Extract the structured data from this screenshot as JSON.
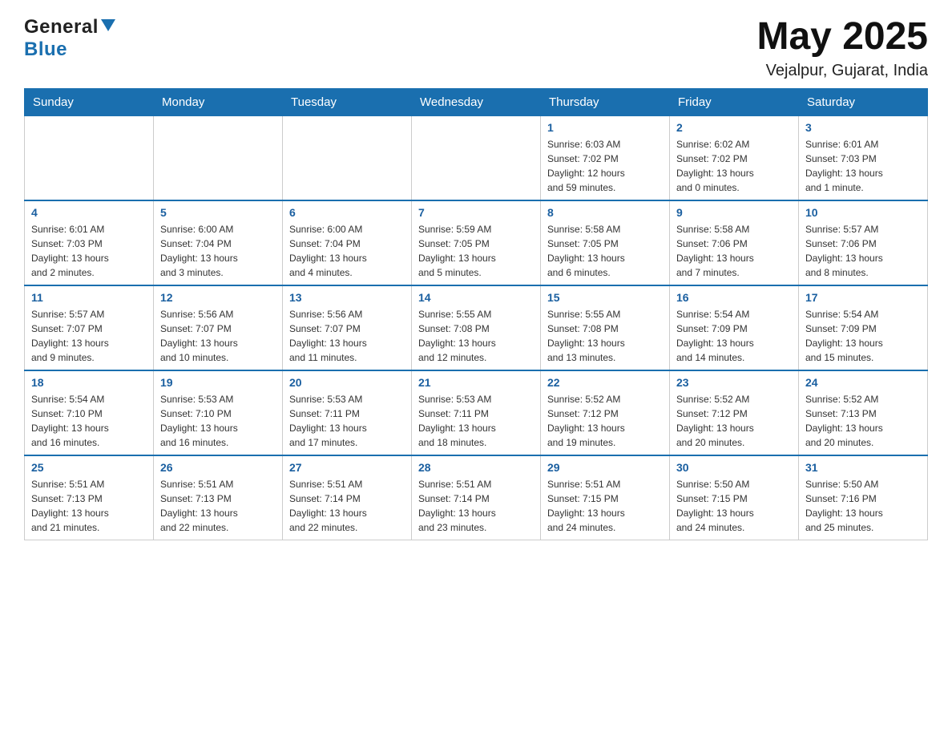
{
  "header": {
    "logo": {
      "general": "General",
      "blue": "Blue"
    },
    "title": "May 2025",
    "location": "Vejalpur, Gujarat, India"
  },
  "calendar": {
    "days_of_week": [
      "Sunday",
      "Monday",
      "Tuesday",
      "Wednesday",
      "Thursday",
      "Friday",
      "Saturday"
    ],
    "weeks": [
      {
        "days": [
          {
            "number": "",
            "info": ""
          },
          {
            "number": "",
            "info": ""
          },
          {
            "number": "",
            "info": ""
          },
          {
            "number": "",
            "info": ""
          },
          {
            "number": "1",
            "info": "Sunrise: 6:03 AM\nSunset: 7:02 PM\nDaylight: 12 hours\nand 59 minutes."
          },
          {
            "number": "2",
            "info": "Sunrise: 6:02 AM\nSunset: 7:02 PM\nDaylight: 13 hours\nand 0 minutes."
          },
          {
            "number": "3",
            "info": "Sunrise: 6:01 AM\nSunset: 7:03 PM\nDaylight: 13 hours\nand 1 minute."
          }
        ]
      },
      {
        "days": [
          {
            "number": "4",
            "info": "Sunrise: 6:01 AM\nSunset: 7:03 PM\nDaylight: 13 hours\nand 2 minutes."
          },
          {
            "number": "5",
            "info": "Sunrise: 6:00 AM\nSunset: 7:04 PM\nDaylight: 13 hours\nand 3 minutes."
          },
          {
            "number": "6",
            "info": "Sunrise: 6:00 AM\nSunset: 7:04 PM\nDaylight: 13 hours\nand 4 minutes."
          },
          {
            "number": "7",
            "info": "Sunrise: 5:59 AM\nSunset: 7:05 PM\nDaylight: 13 hours\nand 5 minutes."
          },
          {
            "number": "8",
            "info": "Sunrise: 5:58 AM\nSunset: 7:05 PM\nDaylight: 13 hours\nand 6 minutes."
          },
          {
            "number": "9",
            "info": "Sunrise: 5:58 AM\nSunset: 7:06 PM\nDaylight: 13 hours\nand 7 minutes."
          },
          {
            "number": "10",
            "info": "Sunrise: 5:57 AM\nSunset: 7:06 PM\nDaylight: 13 hours\nand 8 minutes."
          }
        ]
      },
      {
        "days": [
          {
            "number": "11",
            "info": "Sunrise: 5:57 AM\nSunset: 7:07 PM\nDaylight: 13 hours\nand 9 minutes."
          },
          {
            "number": "12",
            "info": "Sunrise: 5:56 AM\nSunset: 7:07 PM\nDaylight: 13 hours\nand 10 minutes."
          },
          {
            "number": "13",
            "info": "Sunrise: 5:56 AM\nSunset: 7:07 PM\nDaylight: 13 hours\nand 11 minutes."
          },
          {
            "number": "14",
            "info": "Sunrise: 5:55 AM\nSunset: 7:08 PM\nDaylight: 13 hours\nand 12 minutes."
          },
          {
            "number": "15",
            "info": "Sunrise: 5:55 AM\nSunset: 7:08 PM\nDaylight: 13 hours\nand 13 minutes."
          },
          {
            "number": "16",
            "info": "Sunrise: 5:54 AM\nSunset: 7:09 PM\nDaylight: 13 hours\nand 14 minutes."
          },
          {
            "number": "17",
            "info": "Sunrise: 5:54 AM\nSunset: 7:09 PM\nDaylight: 13 hours\nand 15 minutes."
          }
        ]
      },
      {
        "days": [
          {
            "number": "18",
            "info": "Sunrise: 5:54 AM\nSunset: 7:10 PM\nDaylight: 13 hours\nand 16 minutes."
          },
          {
            "number": "19",
            "info": "Sunrise: 5:53 AM\nSunset: 7:10 PM\nDaylight: 13 hours\nand 16 minutes."
          },
          {
            "number": "20",
            "info": "Sunrise: 5:53 AM\nSunset: 7:11 PM\nDaylight: 13 hours\nand 17 minutes."
          },
          {
            "number": "21",
            "info": "Sunrise: 5:53 AM\nSunset: 7:11 PM\nDaylight: 13 hours\nand 18 minutes."
          },
          {
            "number": "22",
            "info": "Sunrise: 5:52 AM\nSunset: 7:12 PM\nDaylight: 13 hours\nand 19 minutes."
          },
          {
            "number": "23",
            "info": "Sunrise: 5:52 AM\nSunset: 7:12 PM\nDaylight: 13 hours\nand 20 minutes."
          },
          {
            "number": "24",
            "info": "Sunrise: 5:52 AM\nSunset: 7:13 PM\nDaylight: 13 hours\nand 20 minutes."
          }
        ]
      },
      {
        "days": [
          {
            "number": "25",
            "info": "Sunrise: 5:51 AM\nSunset: 7:13 PM\nDaylight: 13 hours\nand 21 minutes."
          },
          {
            "number": "26",
            "info": "Sunrise: 5:51 AM\nSunset: 7:13 PM\nDaylight: 13 hours\nand 22 minutes."
          },
          {
            "number": "27",
            "info": "Sunrise: 5:51 AM\nSunset: 7:14 PM\nDaylight: 13 hours\nand 22 minutes."
          },
          {
            "number": "28",
            "info": "Sunrise: 5:51 AM\nSunset: 7:14 PM\nDaylight: 13 hours\nand 23 minutes."
          },
          {
            "number": "29",
            "info": "Sunrise: 5:51 AM\nSunset: 7:15 PM\nDaylight: 13 hours\nand 24 minutes."
          },
          {
            "number": "30",
            "info": "Sunrise: 5:50 AM\nSunset: 7:15 PM\nDaylight: 13 hours\nand 24 minutes."
          },
          {
            "number": "31",
            "info": "Sunrise: 5:50 AM\nSunset: 7:16 PM\nDaylight: 13 hours\nand 25 minutes."
          }
        ]
      }
    ]
  }
}
